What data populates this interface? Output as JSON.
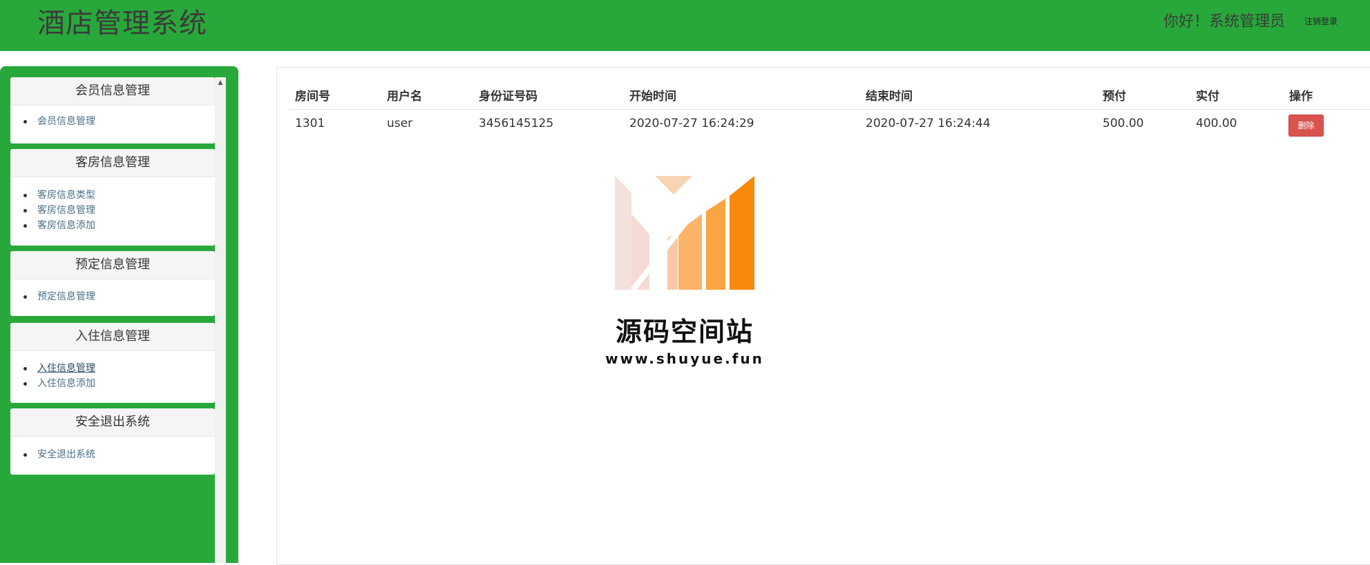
{
  "header": {
    "app_title": "酒店管理系统",
    "greeting": "你好！系统管理员",
    "logout_label": "注销登录"
  },
  "sidebar": {
    "panels": [
      {
        "title": "会员信息管理",
        "items": [
          {
            "label": "会员信息管理"
          }
        ]
      },
      {
        "title": "客房信息管理",
        "items": [
          {
            "label": "客房信息类型"
          },
          {
            "label": "客房信息管理"
          },
          {
            "label": "客房信息添加"
          }
        ]
      },
      {
        "title": "预定信息管理",
        "items": [
          {
            "label": "预定信息管理"
          }
        ]
      },
      {
        "title": "入住信息管理",
        "items": [
          {
            "label": "入住信息管理"
          },
          {
            "label": "入住信息添加"
          }
        ]
      },
      {
        "title": "安全退出系统",
        "items": [
          {
            "label": "安全退出系统"
          }
        ]
      }
    ]
  },
  "table": {
    "columns": [
      "房间号",
      "用户名",
      "身份证号码",
      "开始时间",
      "结束时间",
      "预付",
      "实付",
      "操作"
    ],
    "rows": [
      {
        "room": "1301",
        "user": "user",
        "id_number": "3456145125",
        "start": "2020-07-27 16:24:29",
        "end": "2020-07-27 16:24:44",
        "prepaid": "500.00",
        "paid": "400.00",
        "action": "删除"
      }
    ]
  },
  "watermark": {
    "name": "源码空间站",
    "url": "www.shuyue.fun"
  },
  "colors": {
    "header_green": "#28a83a",
    "delete_red": "#d9534f",
    "logo_orange": "#f7890d"
  }
}
